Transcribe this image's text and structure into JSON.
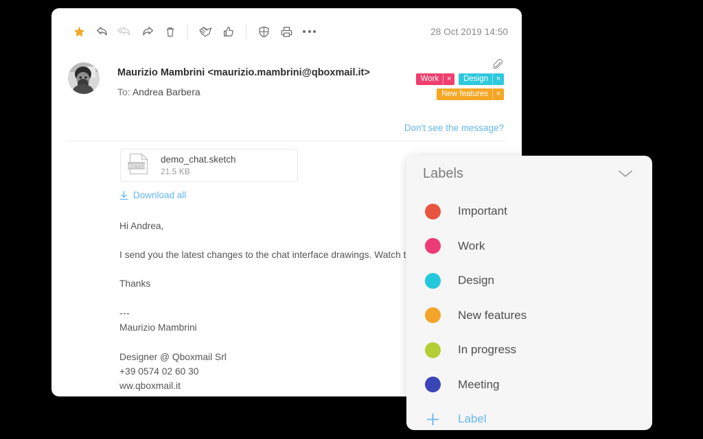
{
  "toolbar": {
    "icons": [
      {
        "name": "star-icon",
        "glyph": "star",
        "state": "active"
      },
      {
        "name": "reply-icon",
        "glyph": "reply",
        "state": "normal"
      },
      {
        "name": "reply-all-icon",
        "glyph": "reply-all",
        "state": "disabled"
      },
      {
        "name": "forward-icon",
        "glyph": "forward",
        "state": "normal"
      },
      {
        "name": "delete-icon",
        "glyph": "trash",
        "state": "normal"
      },
      {
        "name": "separator",
        "glyph": "sep",
        "state": "normal"
      },
      {
        "name": "spam-icon",
        "glyph": "handshake",
        "state": "normal"
      },
      {
        "name": "thumbs-up-icon",
        "glyph": "thumbs-up",
        "state": "normal"
      },
      {
        "name": "separator",
        "glyph": "sep",
        "state": "normal"
      },
      {
        "name": "shield-icon",
        "glyph": "shield",
        "state": "normal"
      },
      {
        "name": "print-icon",
        "glyph": "print",
        "state": "normal"
      },
      {
        "name": "more-options-icon",
        "glyph": "dots",
        "state": "normal"
      }
    ],
    "date": "28 Oct 2019 14:50"
  },
  "message": {
    "sender": "Maurizio Mambrini <maurizio.mambrini@qboxmail.it>",
    "to_prefix": "To:",
    "to_name": "Andrea Barbera",
    "attachment_indicator": "paperclip-icon",
    "tags": [
      {
        "name": "Work",
        "color": "#ef3f6e",
        "close": "×"
      },
      {
        "name": "Design",
        "color": "#2ec9dd",
        "close": "×"
      },
      {
        "name": "New features",
        "color": "#f5a623",
        "close": "×"
      }
    ],
    "dont_see_message": "Don't see the message?",
    "attachment": {
      "file_name": "demo_chat.sketch",
      "file_size": "21.5 KB",
      "icon_label": "SKETCH"
    },
    "download_all": "Download all",
    "body": {
      "greeting": "Hi Andrea,",
      "paragraph": "I send you the latest changes to the chat interface drawings. Watch them and let me",
      "closing": "Thanks",
      "dashes": "---",
      "signature_name": "Maurizio Mambrini",
      "signature_role": "Designer @ Qboxmail Srl",
      "signature_phone": "+39 0574 02 60 30",
      "signature_site": "ww.qboxmail.it"
    }
  },
  "labels_panel": {
    "title": "Labels",
    "collapse_icon": "chevron-down-icon",
    "items": [
      {
        "name": "Important",
        "color": "#e8553f"
      },
      {
        "name": "Work",
        "color": "#ec3b77"
      },
      {
        "name": "Design",
        "color": "#24c8dd"
      },
      {
        "name": "New features",
        "color": "#f3a42a"
      },
      {
        "name": "In progress",
        "color": "#b3cd35"
      },
      {
        "name": "Meeting",
        "color": "#3a45b8"
      }
    ],
    "add_label": "Label",
    "add_icon": "plus-icon"
  },
  "colors": {
    "accent_link": "#63b7f0",
    "star_active": "#f5a623",
    "panel_bg": "#f6f6f6",
    "page_bg": "#000000"
  }
}
